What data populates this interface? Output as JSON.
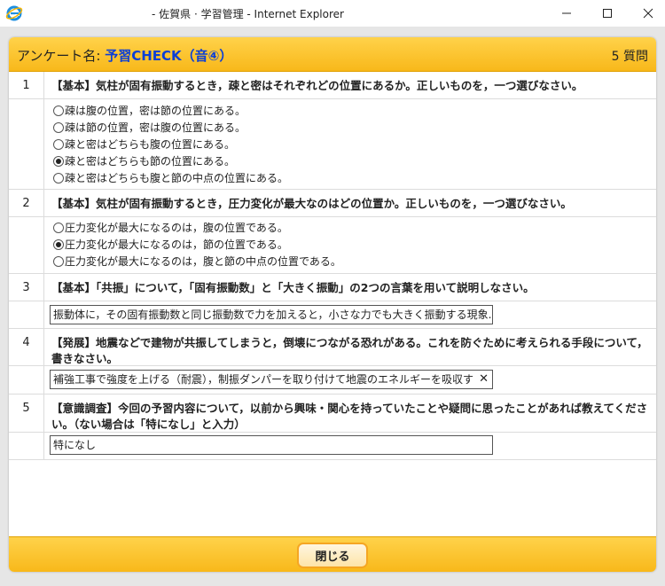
{
  "window": {
    "title": "- 佐賀県 · 学習管理 - Internet Explorer",
    "icon": "internet-explorer-icon"
  },
  "header": {
    "survey_label": "アンケート名: ",
    "survey_name": "予習CHECK（音④）",
    "question_count": "5 質問"
  },
  "questions": [
    {
      "number": "1",
      "text": "【基本】気柱が固有振動するとき，疎と密はそれぞれどの位置にあるか。正しいものを，一つ選びなさい。",
      "options": [
        {
          "label": "疎は腹の位置，密は節の位置にある。",
          "selected": false
        },
        {
          "label": "疎は節の位置，密は腹の位置にある。",
          "selected": false
        },
        {
          "label": "疎と密はどちらも腹の位置にある。",
          "selected": false
        },
        {
          "label": "疎と密はどちらも節の位置にある。",
          "selected": true
        },
        {
          "label": "疎と密はどちらも腹と節の中点の位置にある。",
          "selected": false
        }
      ]
    },
    {
      "number": "2",
      "text": "【基本】気柱が固有振動するとき，圧力変化が最大なのはどの位置か。正しいものを，一つ選びなさい。",
      "options": [
        {
          "label": "圧力変化が最大になるのは，腹の位置である。",
          "selected": false
        },
        {
          "label": "圧力変化が最大になるのは，節の位置である。",
          "selected": true
        },
        {
          "label": "圧力変化が最大になるのは，腹と節の中点の位置である。",
          "selected": false
        }
      ]
    },
    {
      "number": "3",
      "text": "【基本】「共振」について，「固有振動数」と「大きく振動」の2つの言葉を用いて説明しなさい。",
      "answer": "振動体に，その固有振動数と同じ振動数で力を加えると，小さな力でも大きく振動する現象."
    },
    {
      "number": "4",
      "text": "【発展】地震などで建物が共振してしまうと，倒壊につながる恐れがある。これを防ぐために考えられる手段について，書きなさい。",
      "answer": "補強工事で強度を上げる（耐震），制振ダンパーを取り付けて地震のエネルギーを吸収す",
      "clear_symbol": "✕"
    },
    {
      "number": "5",
      "text": "【意識調査】今回の予習内容について，以前から興味・関心を持っていたことや疑問に思ったことがあれば教えてください。（ない場合は「特になし」と入力）",
      "answer": "特になし"
    }
  ],
  "footer": {
    "close_label": "閉じる"
  },
  "colors": {
    "header_gold": "#f8b81a",
    "survey_name_blue": "#0b3fd6",
    "button_border": "#f5a623"
  }
}
